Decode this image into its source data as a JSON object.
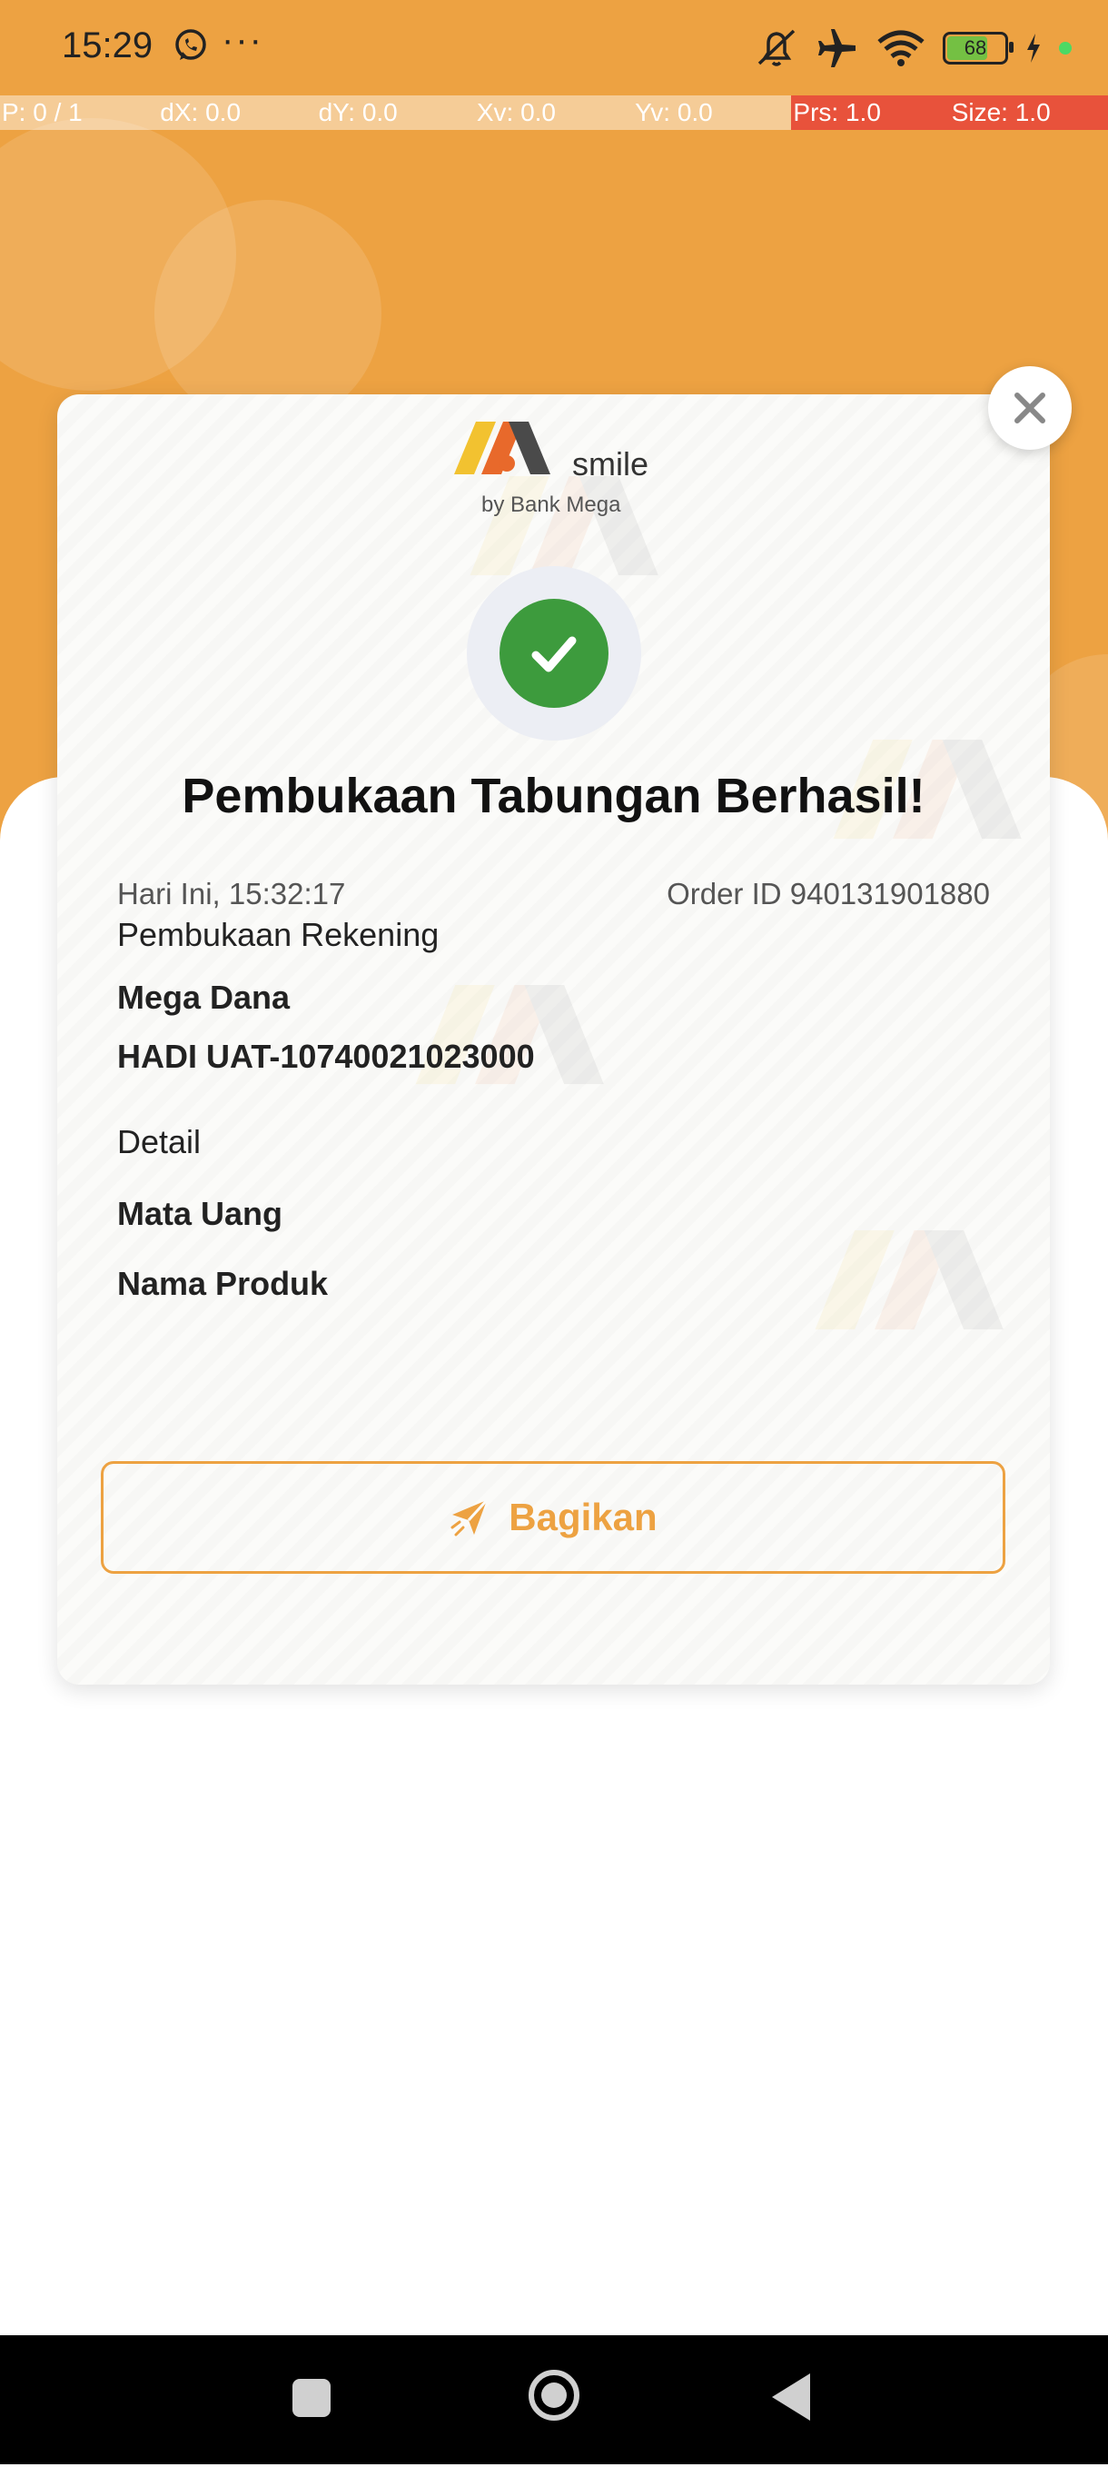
{
  "status_bar": {
    "time": "15:29",
    "dots": "···",
    "battery": "68",
    "icons": [
      "whatsapp-icon",
      "mute-icon",
      "airplane-icon",
      "wifi-icon",
      "battery-icon",
      "charging-icon"
    ]
  },
  "debug_overlay": [
    "P: 0 / 1",
    "dX: 0.0",
    "dY: 0.0",
    "Xv: 0.0",
    "Yv: 0.0",
    "Prs: 1.0",
    "Size: 1.0"
  ],
  "brand": {
    "logo_text": "smile",
    "logo_sub": "by Bank Mega",
    "accent": "#eda242",
    "success": "#3d9b3d",
    "link": "#4aa8dd"
  },
  "receipt": {
    "title": "Pembukaan Tabungan Berhasil!",
    "timestamp": "Hari Ini, 15:32:17",
    "order_id": "Order ID 940131901880",
    "section_label": "Pembukaan Rekening",
    "product": "Mega Dana",
    "account": "HADI UAT-10740021023000",
    "detail_label": "Detail",
    "detail_rows": [
      "Mata Uang",
      "Nama Produk"
    ]
  },
  "actions": {
    "share_label": "Bagikan"
  }
}
